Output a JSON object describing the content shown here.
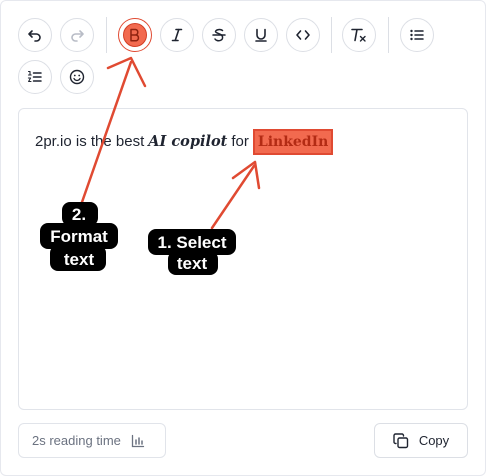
{
  "toolbar": {
    "buttons": [
      {
        "name": "undo",
        "icon": "undo-icon"
      },
      {
        "name": "redo",
        "icon": "redo-icon",
        "disabled": true
      },
      {
        "name": "bold",
        "icon": "bold-icon",
        "active": true
      },
      {
        "name": "italic",
        "icon": "italic-icon"
      },
      {
        "name": "strikethrough",
        "icon": "strikethrough-icon"
      },
      {
        "name": "underline",
        "icon": "underline-icon"
      },
      {
        "name": "code",
        "icon": "code-icon"
      },
      {
        "name": "clear-formatting",
        "icon": "clear-format-icon"
      },
      {
        "name": "bullet-list",
        "icon": "bullet-list-icon"
      },
      {
        "name": "numbered-list",
        "icon": "numbered-list-icon"
      },
      {
        "name": "emoji",
        "icon": "emoji-icon"
      }
    ]
  },
  "editor": {
    "text_prefix": "2pr.io is the best",
    "text_italic": "AI copilot",
    "text_middle": "for",
    "text_selected": "LinkedIn"
  },
  "callouts": {
    "format_line1": "2.",
    "format_line2": "Format",
    "format_line3": "text",
    "select_line1": "1. Select",
    "select_line2": "text"
  },
  "footer": {
    "reading_time": "2s reading time",
    "copy_label": "Copy"
  },
  "colors": {
    "accent": "#f26a4f",
    "arrow": "#e04a32"
  }
}
